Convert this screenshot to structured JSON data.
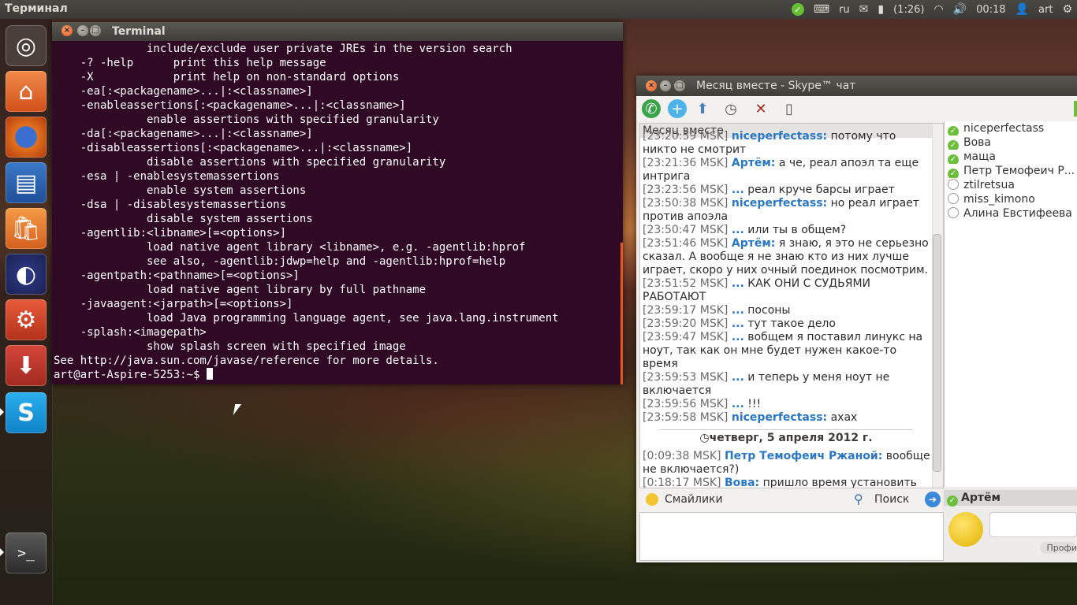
{
  "top_panel": {
    "app_title": "Терминал",
    "keyboard_layout": "ru",
    "battery": "(1:26)",
    "clock": "00:18",
    "user": "art"
  },
  "launcher": {
    "items": [
      "ubuntu-dash",
      "files",
      "firefox",
      "libreoffice-writer",
      "ubuntu-software-center",
      "eclipse",
      "system-settings",
      "update-manager",
      "skype",
      "terminal",
      "workspaces"
    ]
  },
  "terminal": {
    "title": "Terminal",
    "lines": [
      "              include/exclude user private JREs in the version search",
      "    -? -help      print this help message",
      "    -X            print help on non-standard options",
      "    -ea[:<packagename>...|:<classname>]",
      "    -enableassertions[:<packagename>...|:<classname>]",
      "              enable assertions with specified granularity",
      "    -da[:<packagename>...|:<classname>]",
      "    -disableassertions[:<packagename>...|:<classname>]",
      "              disable assertions with specified granularity",
      "    -esa | -enablesystemassertions",
      "              enable system assertions",
      "    -dsa | -disablesystemassertions",
      "              disable system assertions",
      "    -agentlib:<libname>[=<options>]",
      "              load native agent library <libname>, e.g. -agentlib:hprof",
      "              see also, -agentlib:jdwp=help and -agentlib:hprof=help",
      "    -agentpath:<pathname>[=<options>]",
      "              load native agent library by full pathname",
      "    -javaagent:<jarpath>[=<options>]",
      "              load Java programming language agent, see java.lang.instrument",
      "    -splash:<imagepath>",
      "              show splash screen with specified image",
      "See http://java.sun.com/javase/reference for more details."
    ],
    "prompt": "art@art-Aspire-5253:~$ "
  },
  "skype": {
    "title": "Месяц вместе - Skype™ чат",
    "chat_name": "Месяц вместе",
    "messages": [
      {
        "ts": "[23:20:59 MSK]",
        "who": "niceperfectass:",
        "text": " потому что никто не смотрит"
      },
      {
        "ts": "[23:21:36 MSK]",
        "who": "Артём:",
        "text": " а че, реал апоэл та еще интрига"
      },
      {
        "ts": "[23:23:56 MSK]",
        "who": "...",
        "text": " реал круче барсы играет"
      },
      {
        "ts": "[23:50:38 MSK]",
        "who": "niceperfectass:",
        "text": " но реал играет против апоэла"
      },
      {
        "ts": "[23:50:47 MSK]",
        "who": "...",
        "text": " или ты в общем?"
      },
      {
        "ts": "[23:51:46 MSK]",
        "who": "Артём:",
        "text": " я знаю, я это не серьезно сказал. А вообще я не знаю кто из них лучше играет, скоро у них очный поединок посмотрим."
      },
      {
        "ts": "[23:51:52 MSK]",
        "who": "...",
        "text": " КАК ОНИ С СУДЬЯМИ РАБОТАЮТ"
      },
      {
        "ts": "[23:59:17 MSK]",
        "who": "...",
        "text": " посоны"
      },
      {
        "ts": "[23:59:20 MSK]",
        "who": "...",
        "text": " тут такое дело"
      },
      {
        "ts": "[23:59:47 MSK]",
        "who": "...",
        "text": " вобщем я поставил линукс на ноут, так как он мне будет нужен какое-то время"
      },
      {
        "ts": "[23:59:53 MSK]",
        "who": "...",
        "text": " и теперь у меня ноут не включается"
      },
      {
        "ts": "[23:59:56 MSK]",
        "who": "...",
        "text": " !!!"
      },
      {
        "ts": "[23:59:58 MSK]",
        "who": "niceperfectass:",
        "text": " ахах"
      }
    ],
    "date_separator": "четверг, 5 апреля 2012 г.",
    "messages_after": [
      {
        "ts": "[0:09:38 MSK]",
        "who": "Петр Темофеич Ржаной:",
        "text": " вообще не включается?)"
      },
      {
        "ts": "[0:18:17 MSK]",
        "who": "Вова:",
        "text": " пришло время установить ШИНДОУС!!!"
      }
    ],
    "contacts": [
      {
        "name": "niceperfectass",
        "status": "online"
      },
      {
        "name": "Вова",
        "status": "online"
      },
      {
        "name": "маща",
        "status": "online"
      },
      {
        "name": "Петр Темофеич Р...",
        "status": "online"
      },
      {
        "name": "ztilretsua",
        "status": "offline"
      },
      {
        "name": "miss_kimono",
        "status": "offline"
      },
      {
        "name": "Алина Евстифеева",
        "status": "offline"
      }
    ],
    "smileys_label": "Смайлики",
    "search_label": "Поиск",
    "profile_name": "Артём",
    "profile_button": "Профи",
    "colors": {
      "accent": "#e95420",
      "link": "#2a78c4",
      "online": "#6cbf3b"
    }
  }
}
